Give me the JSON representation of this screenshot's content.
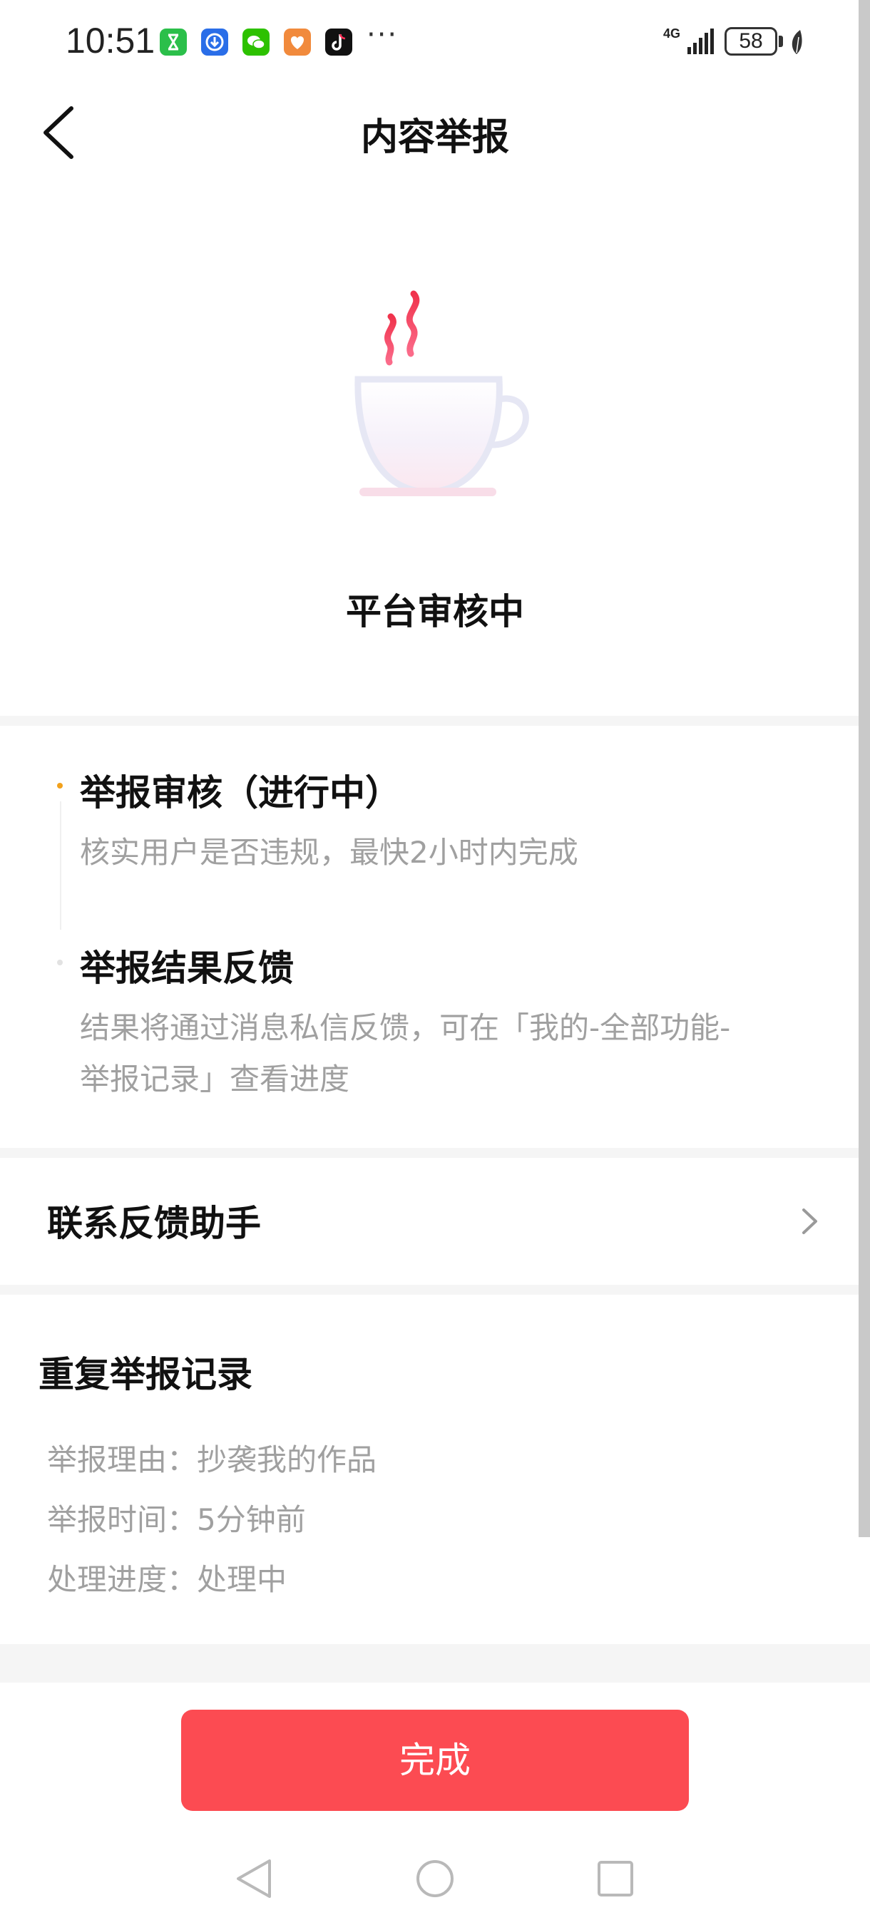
{
  "status_bar": {
    "time": "10:51",
    "network": "4G",
    "battery": "58",
    "app_icons": [
      {
        "name": "hourglass-app-icon",
        "color": "#2bbf4a"
      },
      {
        "name": "shield-app-icon",
        "color": "#2a6ee8"
      },
      {
        "name": "wechat-app-icon",
        "color": "#2dc100"
      },
      {
        "name": "heart-app-icon",
        "color": "#f18a3c"
      },
      {
        "name": "tiktok-app-icon",
        "color": "#111111"
      }
    ],
    "more": "···"
  },
  "header": {
    "title": "内容举报"
  },
  "status": {
    "title": "平台审核中"
  },
  "steps": [
    {
      "title": "举报审核（进行中）",
      "description": "核实用户是否违规，最快2小时内完成",
      "active": true
    },
    {
      "title": "举报结果反馈",
      "description_lines": [
        "结果将通过消息私信反馈，可在「我的-全部功能-",
        "举报记录」查看进度"
      ],
      "active": false
    }
  ],
  "contact": {
    "label": "联系反馈助手"
  },
  "record": {
    "title": "重复举报记录",
    "lines": [
      "举报理由：抄袭我的作品",
      "举报时间：5分钟前",
      "处理进度：处理中"
    ]
  },
  "actions": {
    "done_label": "完成"
  },
  "colors": {
    "accent": "#fc4b52",
    "active_dot": "#f2a11c",
    "muted_text": "#a0a0a0"
  }
}
